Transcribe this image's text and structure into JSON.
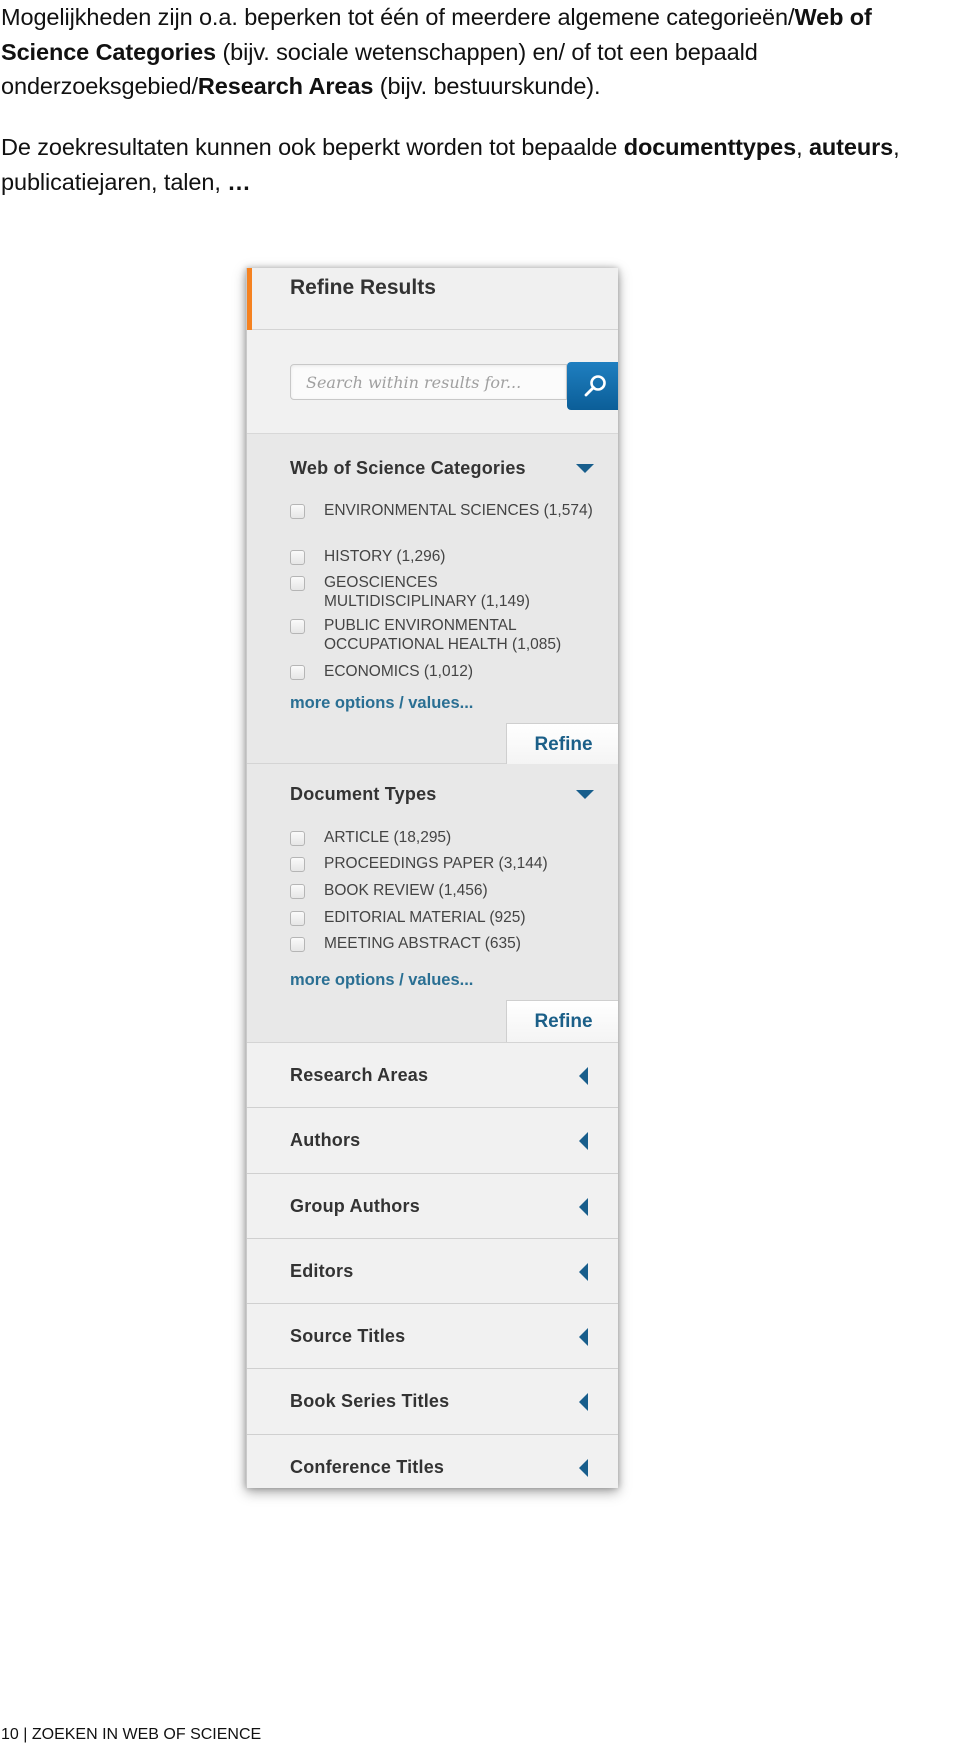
{
  "intro": {
    "para1": {
      "t1": "Mogelijkheden zijn o.a. beperken tot één of meerdere algemene categorieën/",
      "b1": "Web of Science Categories",
      "t2": " (bijv. sociale wetenschappen) en/ of tot een bepaald onderzoeksgebied/",
      "b2": "Research Areas",
      "t3": " (bijv. bestuurskunde)."
    },
    "para2": {
      "t1": "De zoekresultaten kunnen ook beperkt worden tot bepaalde ",
      "b1": "documenttypes",
      "t2": ", ",
      "b2": "auteurs",
      "t3": ", publicatiejaren, talen, ",
      "b3": "…"
    }
  },
  "panel": {
    "title": "Refine Results",
    "accent_color": "#f58220",
    "search": {
      "placeholder": "Search within results for...",
      "button_icon": "search-icon"
    },
    "wos_categories": {
      "title": "Web of Science Categories",
      "items": [
        {
          "label": "ENVIRONMENTAL SCIENCES (1,574)",
          "checked": false
        },
        {
          "label": "HISTORY (1,296)",
          "checked": false
        },
        {
          "label": "GEOSCIENCES MULTIDISCIPLINARY (1,149)",
          "checked": false
        },
        {
          "label": "PUBLIC ENVIRONMENTAL OCCUPATIONAL HEALTH (1,085)",
          "checked": false
        },
        {
          "label": "ECONOMICS (1,012)",
          "checked": false
        }
      ],
      "more_link": "more options / values...",
      "refine_label": "Refine"
    },
    "document_types": {
      "title": "Document Types",
      "items": [
        {
          "label": "ARTICLE (18,295)",
          "checked": false
        },
        {
          "label": "PROCEEDINGS PAPER (3,144)",
          "checked": false
        },
        {
          "label": "BOOK REVIEW (1,456)",
          "checked": false
        },
        {
          "label": "EDITORIAL MATERIAL (925)",
          "checked": false
        },
        {
          "label": "MEETING ABSTRACT (635)",
          "checked": false
        }
      ],
      "more_link": "more options / values...",
      "refine_label": "Refine"
    },
    "collapsed_sections": [
      {
        "title": "Research Areas"
      },
      {
        "title": "Authors"
      },
      {
        "title": "Group Authors"
      },
      {
        "title": "Editors"
      },
      {
        "title": "Source Titles"
      },
      {
        "title": "Book Series Titles"
      },
      {
        "title": "Conference Titles"
      }
    ]
  },
  "footer": {
    "text": "10 | ZOEKEN IN WEB OF SCIENCE"
  }
}
